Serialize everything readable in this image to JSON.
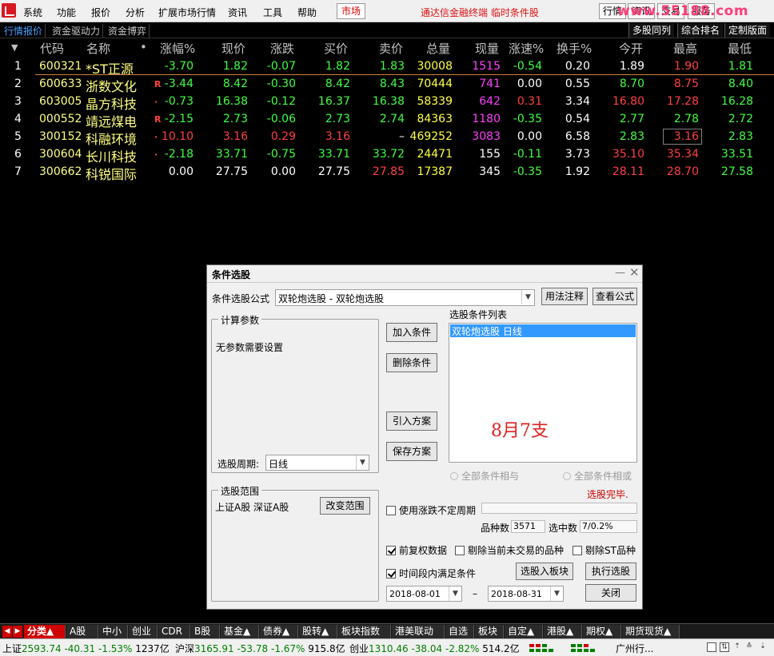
{
  "menubar": {
    "items": [
      "系统",
      "功能",
      "报价",
      "分析",
      "扩展市场行情",
      "资讯",
      "工具",
      "帮助"
    ],
    "market_button": "市场",
    "app_title": "通达信金融终端  临时条件股",
    "right_buttons": [
      "行情",
      "资讯",
      "交易",
      "服务"
    ],
    "watermark": "www.55188.com"
  },
  "subbar": {
    "tabs": [
      "行情报价",
      "资金驱动力",
      "资金博弈"
    ],
    "right_tabs": [
      "多股同列",
      "综合排名",
      "定制版面"
    ]
  },
  "table": {
    "headers": [
      "代码",
      "名称",
      "涨幅%",
      "现价",
      "涨跌",
      "买价",
      "卖价",
      "总量",
      "现量",
      "涨速%",
      "换手%",
      "今开",
      "最高",
      "最低"
    ],
    "rows": [
      {
        "no": "1",
        "code": "600321",
        "name": "*ST正源",
        "mark": "",
        "chg_pct": "-3.70",
        "price": "1.82",
        "chg": "-0.07",
        "bid": "1.82",
        "ask": "1.83",
        "vol": "30008",
        "cur_vol": "1515",
        "speed": "-0.54",
        "turnover": "0.20",
        "open": "1.89",
        "high": "1.90",
        "low": "1.81"
      },
      {
        "no": "2",
        "code": "600633",
        "name": "浙数文化",
        "mark": "R",
        "chg_pct": "-3.44",
        "price": "8.42",
        "chg": "-0.30",
        "bid": "8.42",
        "ask": "8.43",
        "vol": "70444",
        "cur_vol": "741",
        "speed": "0.00",
        "turnover": "0.55",
        "open": "8.70",
        "high": "8.75",
        "low": "8.40"
      },
      {
        "no": "3",
        "code": "603005",
        "name": "晶方科技",
        "mark": "·",
        "chg_pct": "-0.73",
        "price": "16.38",
        "chg": "-0.12",
        "bid": "16.37",
        "ask": "16.38",
        "vol": "58339",
        "cur_vol": "642",
        "speed": "0.31",
        "turnover": "3.34",
        "open": "16.80",
        "high": "17.28",
        "low": "16.28"
      },
      {
        "no": "4",
        "code": "000552",
        "name": "靖远煤电",
        "mark": "R",
        "chg_pct": "-2.15",
        "price": "2.73",
        "chg": "-0.06",
        "bid": "2.73",
        "ask": "2.74",
        "vol": "84363",
        "cur_vol": "1180",
        "speed": "-0.35",
        "turnover": "0.54",
        "open": "2.77",
        "high": "2.78",
        "low": "2.72"
      },
      {
        "no": "5",
        "code": "300152",
        "name": "科融环境",
        "mark": "·",
        "chg_pct": "10.10",
        "price": "3.16",
        "chg": "0.29",
        "bid": "3.16",
        "ask": "–",
        "vol": "469252",
        "cur_vol": "3083",
        "speed": "0.00",
        "turnover": "6.58",
        "open": "2.83",
        "high": "3.16",
        "low": "2.83"
      },
      {
        "no": "6",
        "code": "300604",
        "name": "长川科技",
        "mark": "·",
        "chg_pct": "-2.18",
        "price": "33.71",
        "chg": "-0.75",
        "bid": "33.71",
        "ask": "33.72",
        "vol": "24471",
        "cur_vol": "155",
        "speed": "-0.11",
        "turnover": "3.73",
        "open": "35.10",
        "high": "35.34",
        "low": "33.51"
      },
      {
        "no": "7",
        "code": "300662",
        "name": "科锐国际",
        "mark": "",
        "chg_pct": "0.00",
        "price": "27.75",
        "chg": "0.00",
        "bid": "27.75",
        "ask": "27.85",
        "vol": "17387",
        "cur_vol": "345",
        "speed": "-0.35",
        "turnover": "1.92",
        "open": "28.11",
        "high": "28.70",
        "low": "27.58"
      }
    ]
  },
  "dialog": {
    "title": "条件选股",
    "formula_label": "条件选股公式",
    "formula_value": "双轮炮选股   - 双轮炮选股",
    "usage_button": "用法注释",
    "view_formula_button": "查看公式",
    "params_group": "计算参数",
    "params_text": "无参数需要设置",
    "period_label": "选股周期:",
    "period_value": "日线",
    "add_button": "加入条件",
    "delete_button": "删除条件",
    "import_button": "引入方案",
    "save_button": "保存方案",
    "cond_list_label": "选股条件列表",
    "cond_list_item": "双轮炮选股  日线",
    "note": "8月7支",
    "radio_and": "全部条件相与",
    "radio_or": "全部条件相或",
    "status": "选股完毕.",
    "range_group": "选股范围",
    "range_text": "上证A股 深证A股",
    "change_range_button": "改变范围",
    "use_variable_period": "使用涨跌不定周期",
    "count_label": "品种数",
    "count_value": "3571",
    "selected_label": "选中数",
    "selected_value": "7/0.2%",
    "pre_rights": "前复权数据",
    "exclude_untraded": "剔除当前未交易的品种",
    "exclude_st": "剔除ST品种",
    "time_range": "时间段内满足条件",
    "to_block_button": "选股入板块",
    "execute_button": "执行选股",
    "date_from": "2018-08-01",
    "date_sep": "–",
    "date_to": "2018-08-31",
    "close_button": "关闭"
  },
  "bottom_tabs": [
    "分类▲",
    "A股",
    "中小",
    "创业",
    "CDR",
    "B股",
    "基金▲",
    "债券▲",
    "股转▲",
    "板块指数",
    "港美联动",
    "自选",
    "板块",
    "自定▲",
    "港股▲",
    "期权▲",
    "期货现货▲"
  ],
  "statusbar": {
    "sh": {
      "name": "上证",
      "price": "2593.74",
      "chg": "-40.31",
      "pct": "-1.53%",
      "amt": "1237亿"
    },
    "hs": {
      "name": "沪深",
      "price": "3165.91",
      "chg": "-53.78",
      "pct": "-1.67%",
      "amt": "915.8亿"
    },
    "cy": {
      "name": "创业",
      "price": "1310.46",
      "chg": "-38.04",
      "pct": "-2.82%",
      "amt": "514.2亿"
    },
    "region": "广州行..."
  },
  "colors": {
    "up": "#ff4040",
    "down": "#40ff40",
    "accent": "#d00000"
  }
}
